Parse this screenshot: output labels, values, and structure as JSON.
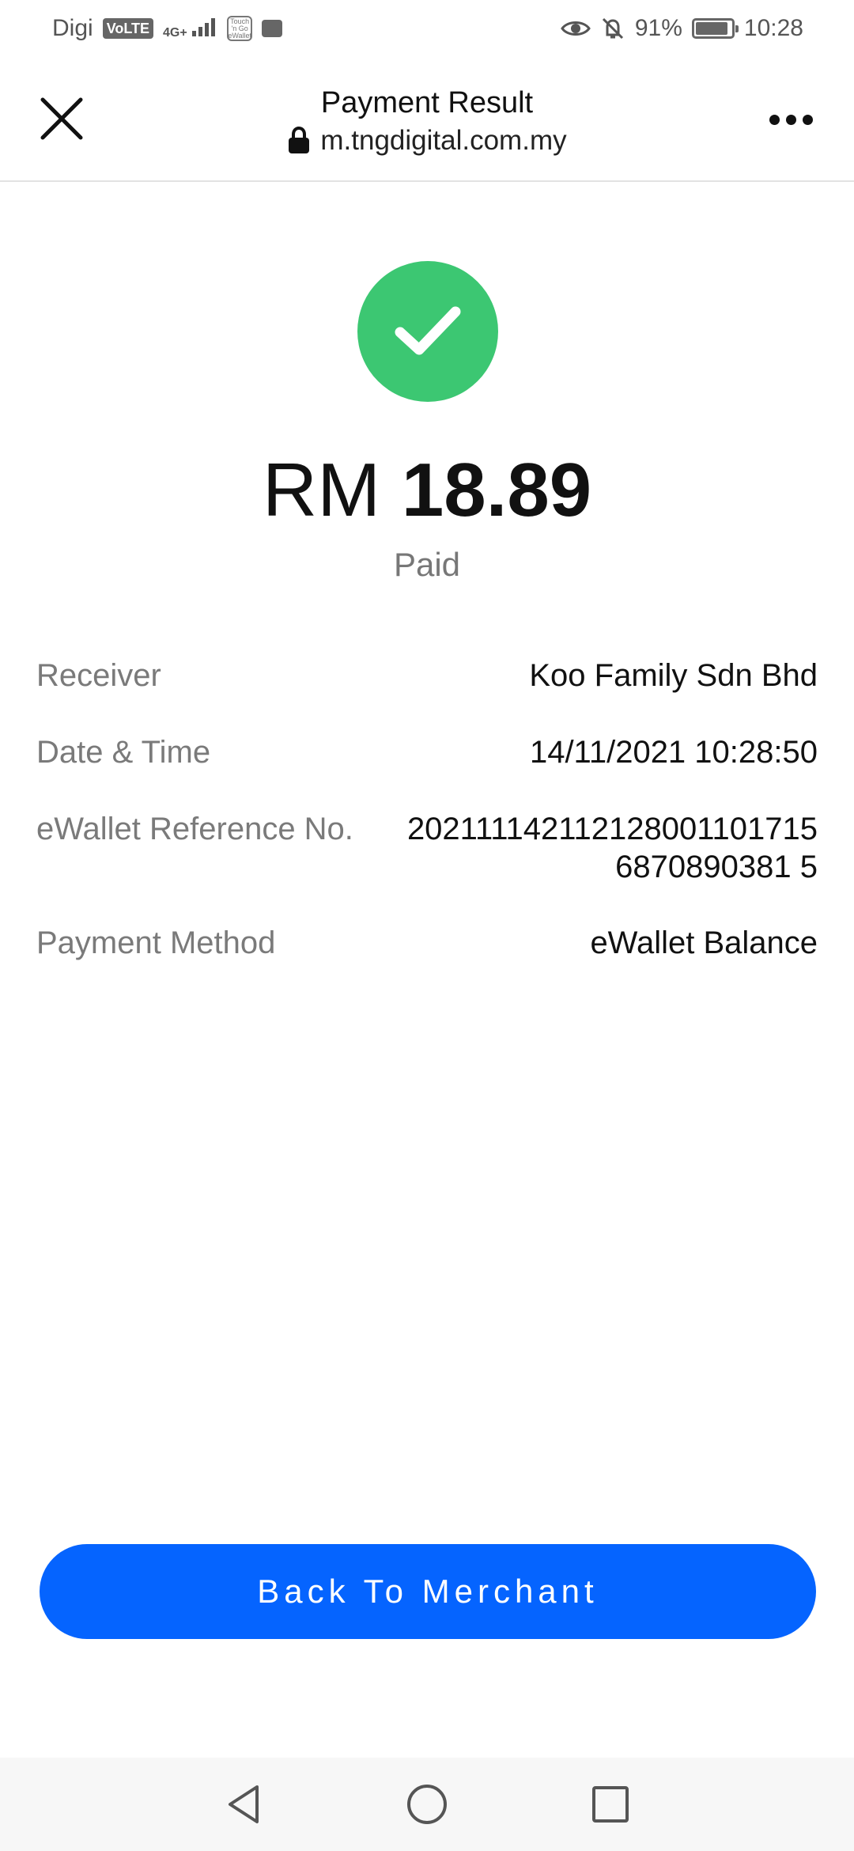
{
  "status_bar": {
    "carrier": "Digi",
    "volte": "VoLTE",
    "network": "4G+",
    "wallet_badge": "Touch 'n Go eWallet",
    "battery_percent": "91%",
    "battery_level": 0.91,
    "time": "10:28",
    "icons": [
      "eye-icon",
      "bell-off-icon",
      "battery-icon",
      "message-icon",
      "signal-icon"
    ]
  },
  "header": {
    "title": "Payment Result",
    "url": "m.tngdigital.com.my",
    "close_icon": "close-icon",
    "lock_icon": "lock-icon",
    "more_icon": "more-icon"
  },
  "result": {
    "status_icon": "check-icon",
    "status_color": "#3cc772",
    "currency": "RM",
    "amount": "18.89",
    "status_text": "Paid"
  },
  "details": [
    {
      "label": "Receiver",
      "value": "Koo Family Sdn Bhd"
    },
    {
      "label": "Date & Time",
      "value": "14/11/2021 10:28:50"
    },
    {
      "label": "eWallet Reference No.",
      "value": "2021111421121280011017156870890381 5"
    },
    {
      "label": "Payment Method",
      "value": "eWallet Balance"
    }
  ],
  "action": {
    "back_label": "Back To Merchant",
    "color": "#0564ff"
  },
  "nav_bar": {
    "icons": [
      "back-triangle-icon",
      "home-circle-icon",
      "recents-square-icon"
    ]
  }
}
